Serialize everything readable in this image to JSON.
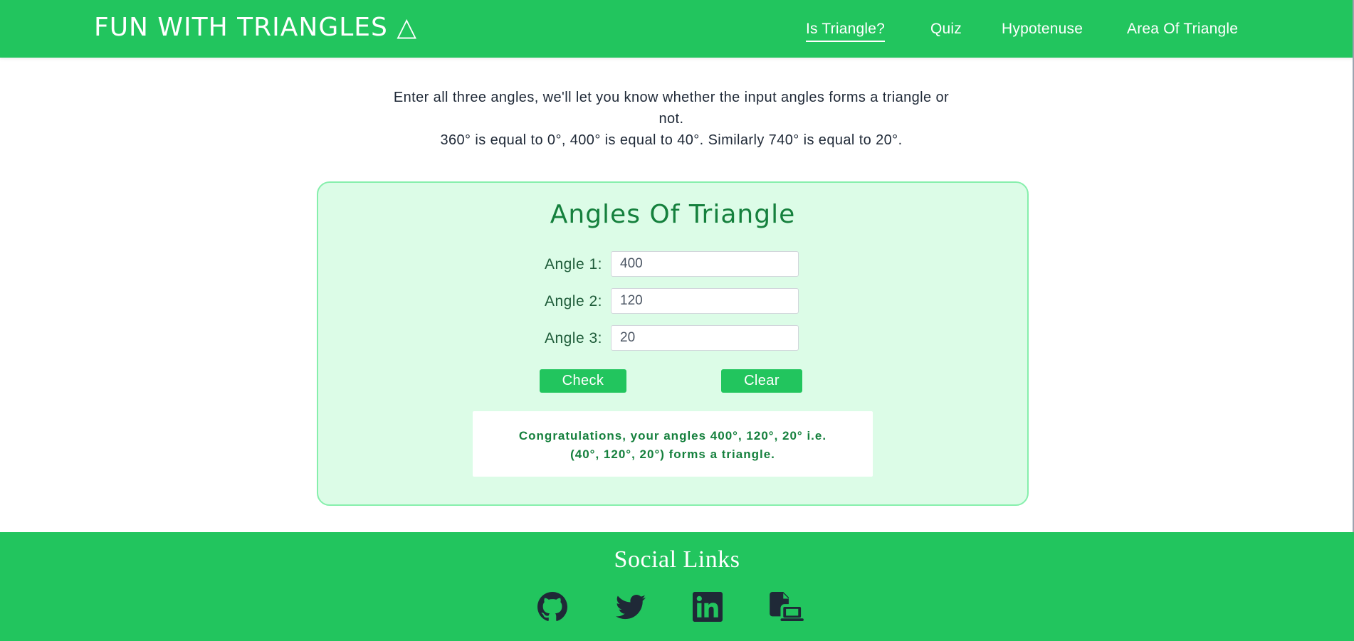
{
  "header": {
    "brand": "FUN WITH TRIANGLES △",
    "nav": [
      {
        "label": "Is Triangle?",
        "active": true
      },
      {
        "label": "Quiz"
      },
      {
        "label": "Hypotenuse"
      },
      {
        "label": "Area Of Triangle"
      }
    ]
  },
  "intro": {
    "line1": "Enter all three angles, we'll let you know whether the input angles forms a triangle or not.",
    "line2": "360° is equal to 0°, 400° is equal to 40°. Similarly 740° is equal to 20°."
  },
  "card": {
    "title": "Angles Of Triangle",
    "angles": [
      {
        "label": "Angle 1:",
        "value": "400"
      },
      {
        "label": "Angle 2:",
        "value": "120"
      },
      {
        "label": "Angle 3:",
        "value": "20"
      }
    ],
    "check_label": "Check",
    "clear_label": "Clear",
    "result_line1": "Congratulations, your angles 400°, 120°, 20° i.e.",
    "result_line2": "(40°, 120°, 20°) forms a triangle."
  },
  "footer": {
    "title": "Social Links",
    "icons": [
      "github-icon",
      "twitter-icon",
      "linkedin-icon",
      "portfolio-icon"
    ]
  },
  "colors": {
    "primary": "#22c55e",
    "card_bg": "#dcfce7",
    "card_border": "#86efac",
    "title_green": "#15803d"
  }
}
